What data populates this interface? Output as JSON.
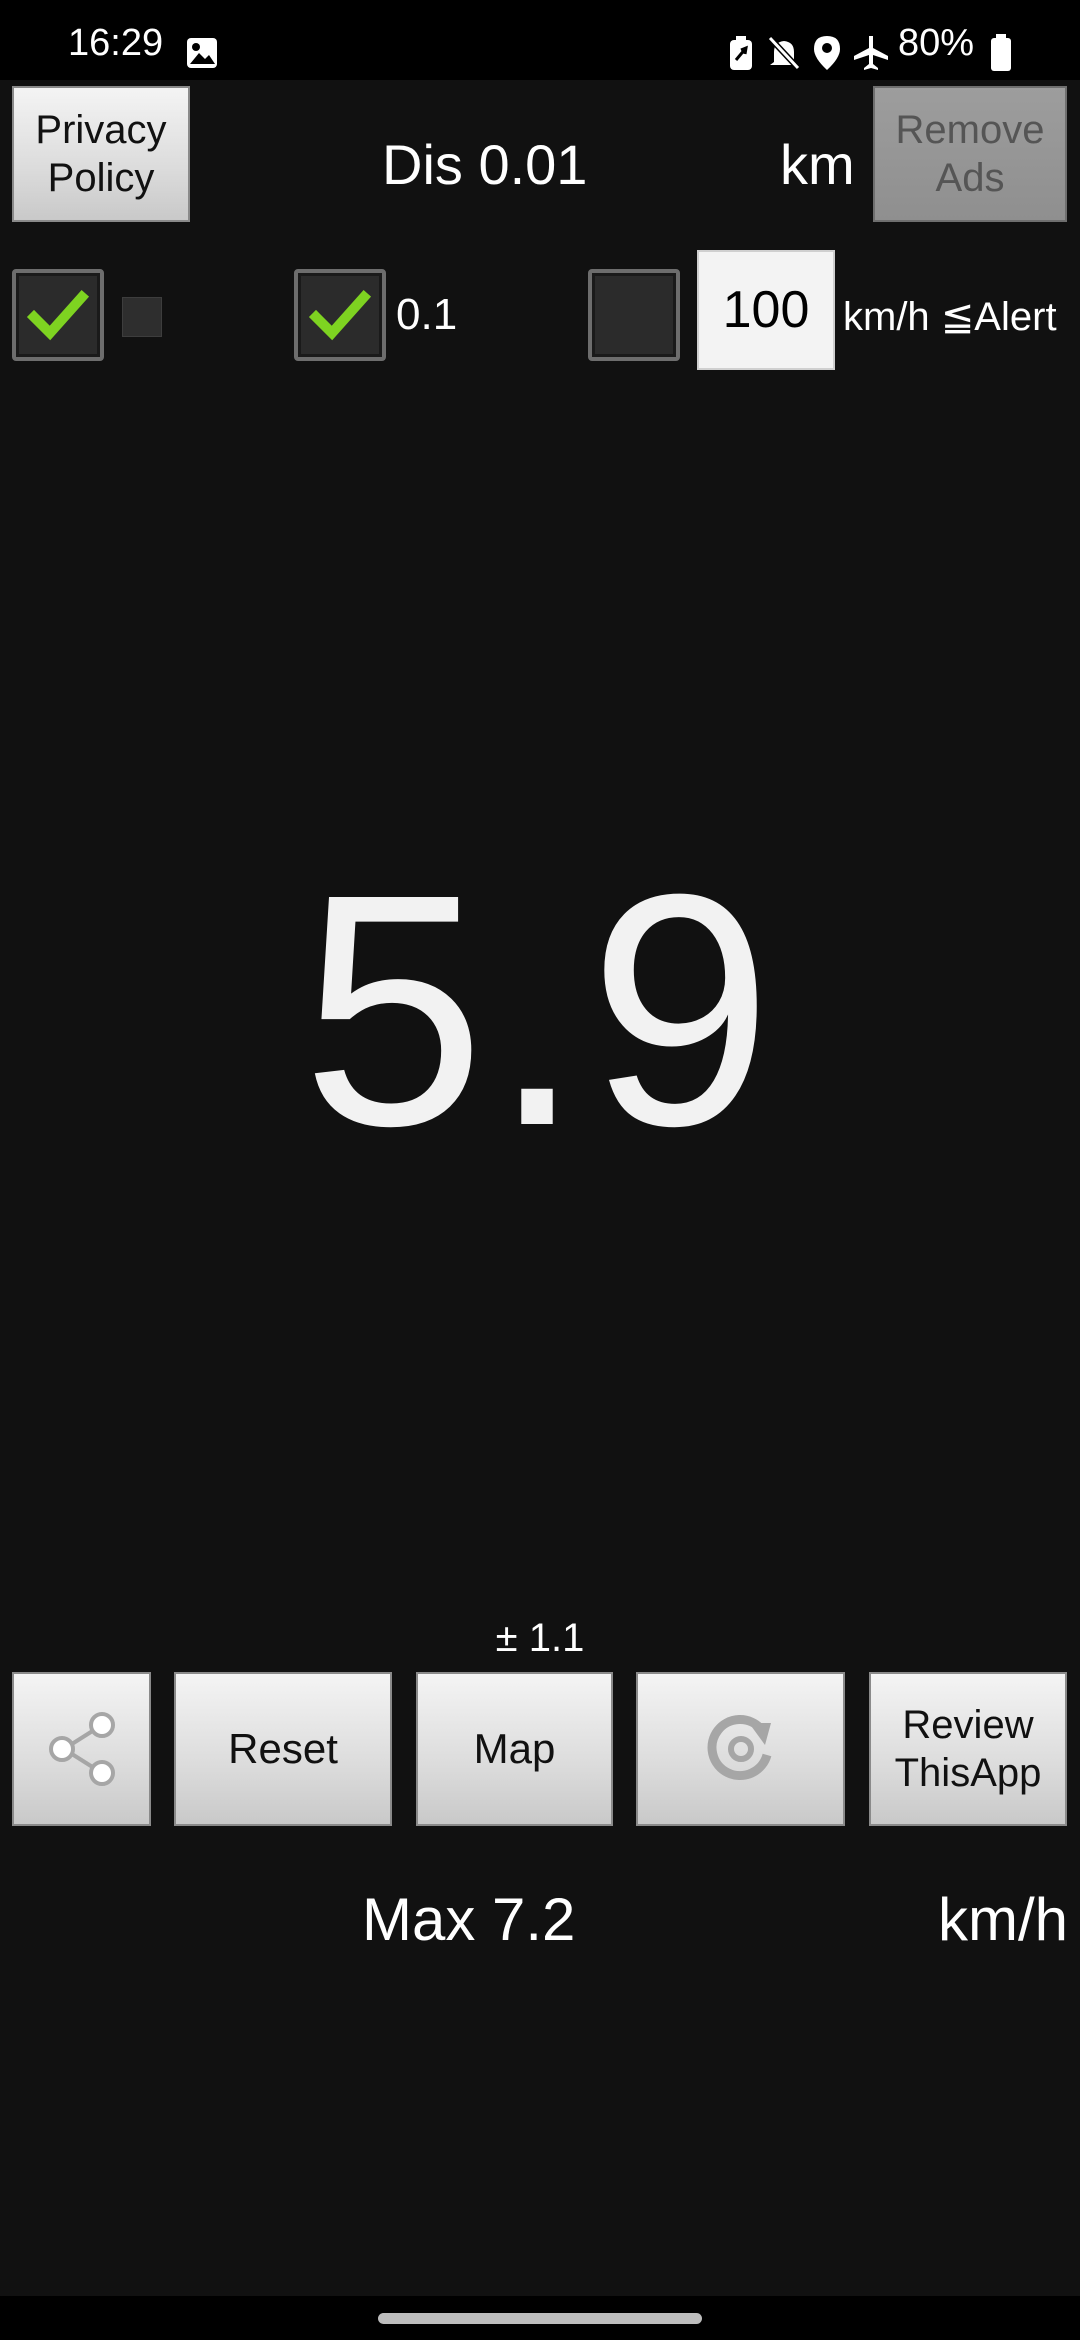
{
  "status_bar": {
    "time": "16:29",
    "battery": "80%",
    "icons": [
      "image-icon",
      "battery-saver-icon",
      "mute-icon",
      "location-icon",
      "airplane-icon",
      "battery-icon"
    ]
  },
  "header": {
    "privacy_label": "Privacy\nPolicy",
    "distance_label": "Dis 0.01",
    "distance_unit": "km",
    "remove_ads_label": "Remove\nAds"
  },
  "options": {
    "checkbox1_checked": true,
    "checkbox2_checked": true,
    "checkbox2_label": "0.1",
    "checkbox3_checked": false,
    "alert_value": "100",
    "alert_label": "km/h ≦Alert"
  },
  "speed": {
    "value": "5.9",
    "accuracy": "± 1.1"
  },
  "buttons": {
    "share_icon": "share-icon",
    "reset_label": "Reset",
    "map_label": "Map",
    "refresh_icon": "refresh-icon",
    "review_label": "Review\nThisApp"
  },
  "max": {
    "label": "Max 7.2",
    "unit": "km/h"
  },
  "colors": {
    "background": "#111111",
    "check_green": "#7ed321",
    "button_grey": "#dcdcdc"
  }
}
